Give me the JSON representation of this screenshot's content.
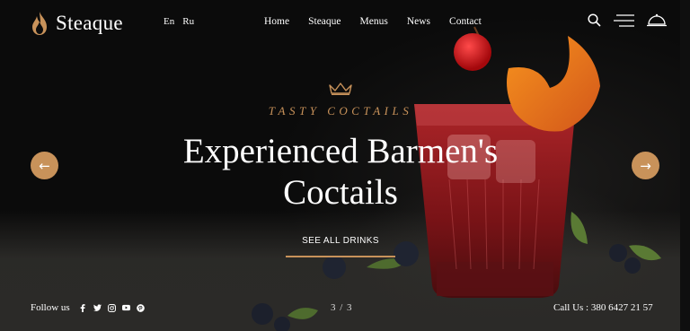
{
  "brand": {
    "name": "Steaque",
    "accent": "#c8925a"
  },
  "languages": [
    "En",
    "Ru"
  ],
  "nav": [
    "Home",
    "Steaque",
    "Menus",
    "News",
    "Contact"
  ],
  "header_icons": [
    "search-icon",
    "menu-icon",
    "cloche-icon"
  ],
  "hero": {
    "kicker": "TASTY COCTAILS",
    "headline_line1": "Experienced Barmen's",
    "headline_line2": "Coctails",
    "cta": "SEE ALL DRINKS"
  },
  "slider": {
    "prev_icon": "←",
    "next_icon": "→",
    "counter": "3 / 3"
  },
  "footer": {
    "follow_label": "Follow us",
    "social": [
      "facebook-icon",
      "twitter-icon",
      "instagram-icon",
      "youtube-icon",
      "pinterest-icon"
    ],
    "call_us": "Call Us : 380 6427 21 57"
  }
}
